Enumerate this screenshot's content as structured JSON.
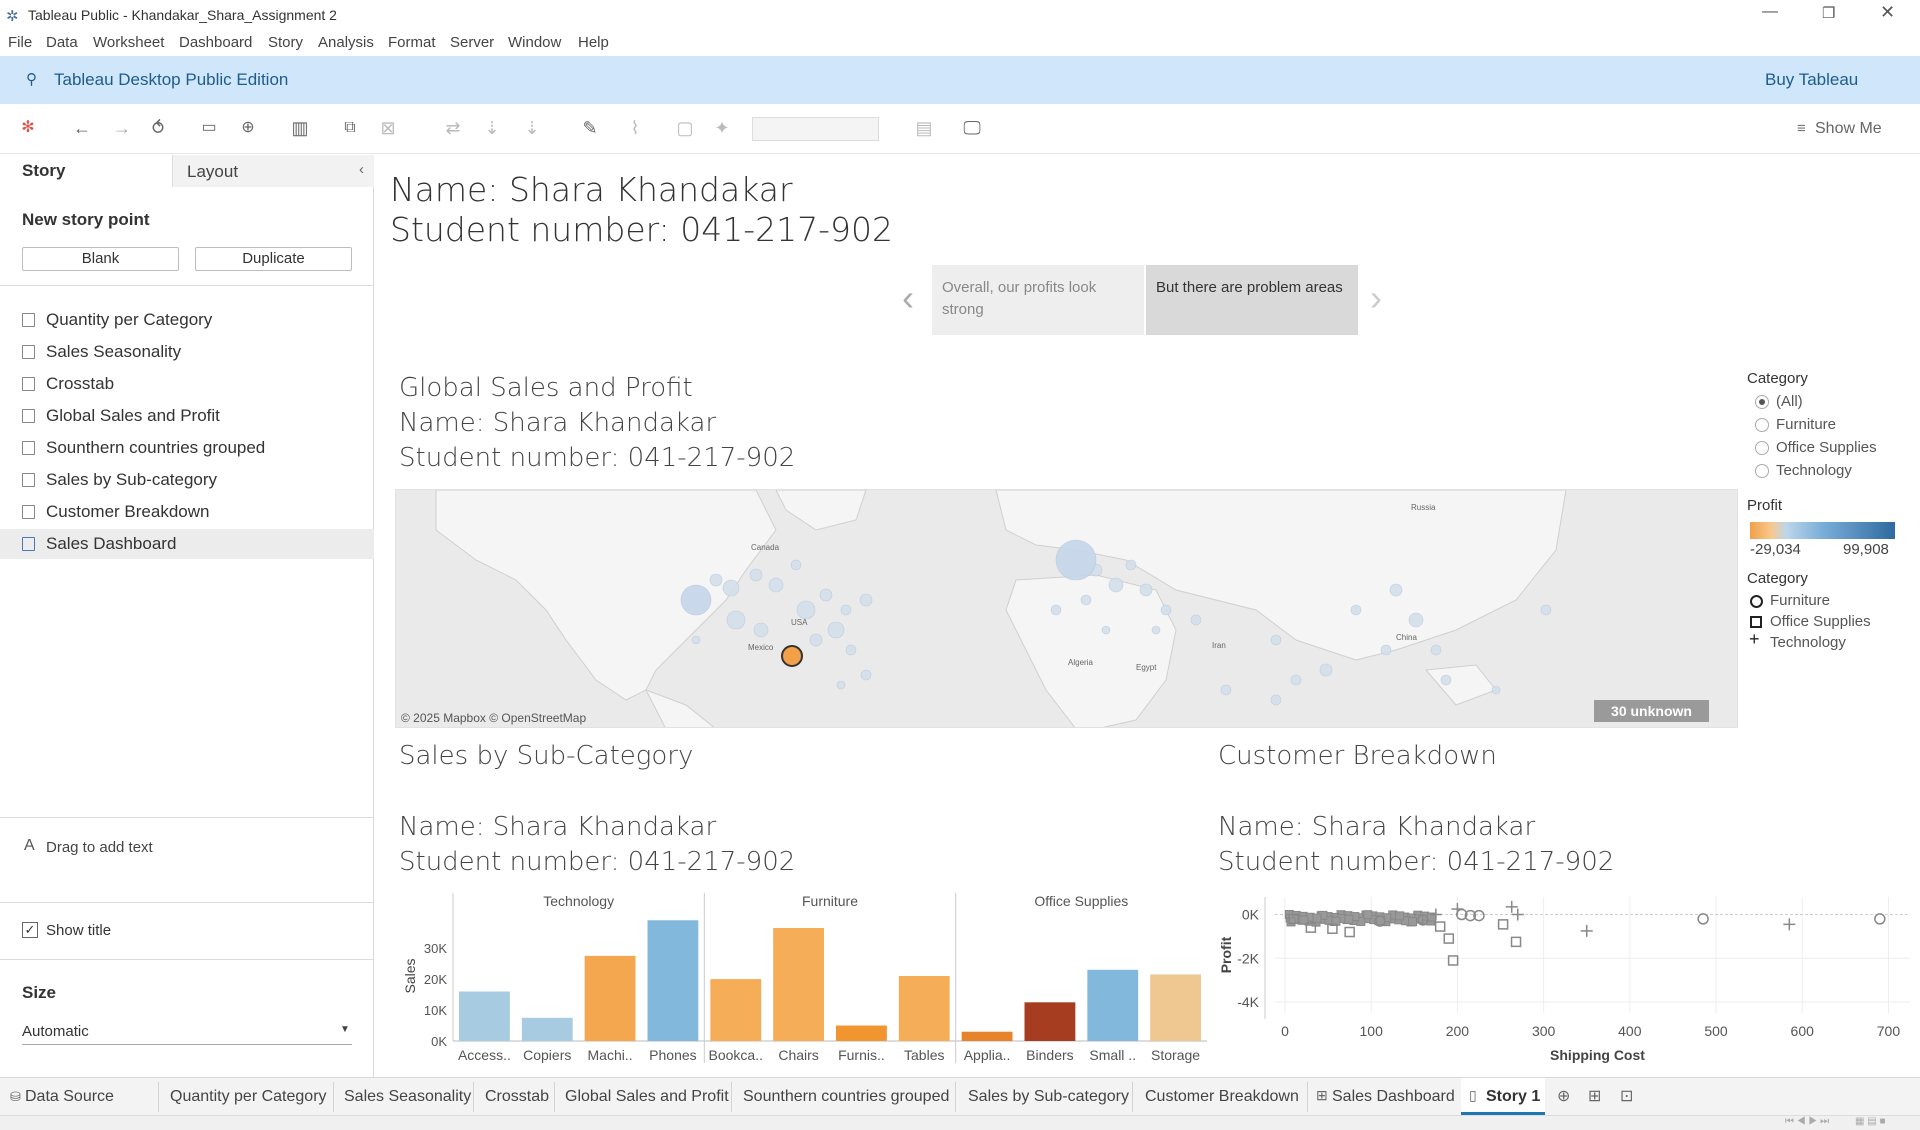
{
  "window": {
    "title": "Tableau Public - Khandakar_Shara_Assignment 2"
  },
  "menu": [
    "File",
    "Data",
    "Worksheet",
    "Dashboard",
    "Story",
    "Analysis",
    "Format",
    "Server",
    "Window",
    "Help"
  ],
  "banner": {
    "edition": "Tableau Desktop Public Edition",
    "buy": "Buy Tableau"
  },
  "toolbar": {
    "show_me": "Show Me"
  },
  "left_pane": {
    "tabs": [
      "Story",
      "Layout"
    ],
    "new_story_point": "New story point",
    "blank": "Blank",
    "duplicate": "Duplicate",
    "sheets": [
      "Quantity per Category",
      "Sales Seasonality",
      "Crosstab",
      "Global Sales and Profit",
      "Sounthern countries grouped",
      "Sales by Sub-category",
      "Customer Breakdown",
      "Sales Dashboard"
    ],
    "drag_text": "Drag to add text",
    "show_title": "Show title",
    "size_label": "Size",
    "size_value": "Automatic"
  },
  "story": {
    "name": "Name: Shara Khandakar",
    "student": "Student number: 041-217-902",
    "captions": [
      "Overall, our profits look strong",
      "But there are problem areas"
    ]
  },
  "dashboard": {
    "map_title": "Global Sales and Profit",
    "name": "Name: Shara Khandakar",
    "student": "Student number: 041-217-902",
    "map_credit": "© 2025 Mapbox © OpenStreetMap",
    "unknown_badge": "30 unknown",
    "map_labels": [
      "Canada",
      "USA",
      "Mexico",
      "Russia",
      "China",
      "Algeria",
      "Egypt",
      "Iran"
    ],
    "bar_title": "Sales by Sub-Category",
    "scatter_title": "Customer Breakdown"
  },
  "legend": {
    "category_filter_title": "Category",
    "category_options": [
      "(All)",
      "Furniture",
      "Office Supplies",
      "Technology"
    ],
    "profit_title": "Profit",
    "profit_min": "-29,034",
    "profit_max": "99,908",
    "shape_title": "Category",
    "shape_items": [
      "Furniture",
      "Office Supplies",
      "Technology"
    ],
    "colors": {
      "low": "#f2a048",
      "high": "#2e6aa0"
    }
  },
  "chart_data": [
    {
      "type": "bar",
      "ylabel": "Sales",
      "yticks": [
        "0K",
        "10K",
        "20K",
        "30K"
      ],
      "groups": [
        {
          "name": "Technology",
          "categories": [
            "Access..",
            "Copiers",
            "Machi..",
            "Phones"
          ],
          "values": [
            16000,
            7500,
            27500,
            39000
          ],
          "colors": [
            "#a7cbe0",
            "#a7cbe0",
            "#f5a74f",
            "#82b8dc"
          ]
        },
        {
          "name": "Furniture",
          "categories": [
            "Bookca..",
            "Chairs",
            "Furnis..",
            "Tables"
          ],
          "values": [
            20000,
            36500,
            5000,
            21000
          ],
          "colors": [
            "#f5ad58",
            "#f5ad58",
            "#f0952f",
            "#f5ad58"
          ]
        },
        {
          "name": "Office Supplies",
          "categories": [
            "Applia..",
            "Binders",
            "Small ..",
            "Storage"
          ],
          "values": [
            3000,
            12500,
            23000,
            21500
          ],
          "colors": [
            "#e7832a",
            "#a63d20",
            "#82b8dc",
            "#efc791"
          ]
        }
      ]
    },
    {
      "type": "scatter",
      "xlabel": "Shipping Cost",
      "ylabel": "Profit",
      "xticks": [
        "0",
        "100",
        "200",
        "300",
        "400",
        "500",
        "600",
        "700"
      ],
      "yticks": [
        "0K",
        "-2K",
        "-4K"
      ],
      "points": [
        {
          "x": 10,
          "y": -200,
          "s": "square"
        },
        {
          "x": 30,
          "y": -600,
          "s": "square"
        },
        {
          "x": 55,
          "y": -650,
          "s": "square"
        },
        {
          "x": 75,
          "y": -800,
          "s": "square"
        },
        {
          "x": 110,
          "y": -300,
          "s": "circle"
        },
        {
          "x": 160,
          "y": -250,
          "s": "circle"
        },
        {
          "x": 175,
          "y": 0,
          "s": "plus"
        },
        {
          "x": 180,
          "y": -550,
          "s": "square"
        },
        {
          "x": 190,
          "y": -1100,
          "s": "square"
        },
        {
          "x": 195,
          "y": -2100,
          "s": "square"
        },
        {
          "x": 200,
          "y": 250,
          "s": "plus"
        },
        {
          "x": 205,
          "y": 0,
          "s": "circle"
        },
        {
          "x": 215,
          "y": -50,
          "s": "circle"
        },
        {
          "x": 225,
          "y": -50,
          "s": "circle"
        },
        {
          "x": 253,
          "y": -450,
          "s": "square"
        },
        {
          "x": 263,
          "y": 350,
          "s": "plus"
        },
        {
          "x": 270,
          "y": 0,
          "s": "plus"
        },
        {
          "x": 268,
          "y": -1250,
          "s": "square"
        },
        {
          "x": 350,
          "y": -750,
          "s": "plus"
        },
        {
          "x": 485,
          "y": -200,
          "s": "circle"
        },
        {
          "x": 585,
          "y": -450,
          "s": "plus"
        },
        {
          "x": 690,
          "y": -200,
          "s": "circle"
        }
      ]
    }
  ],
  "bottom_tabs": [
    "Data Source",
    "Quantity per Category",
    "Sales Seasonality",
    "Crosstab",
    "Global Sales and Profit",
    "Sounthern countries grouped",
    "Sales by Sub-category",
    "Customer Breakdown",
    "Sales Dashboard",
    "Story 1"
  ]
}
